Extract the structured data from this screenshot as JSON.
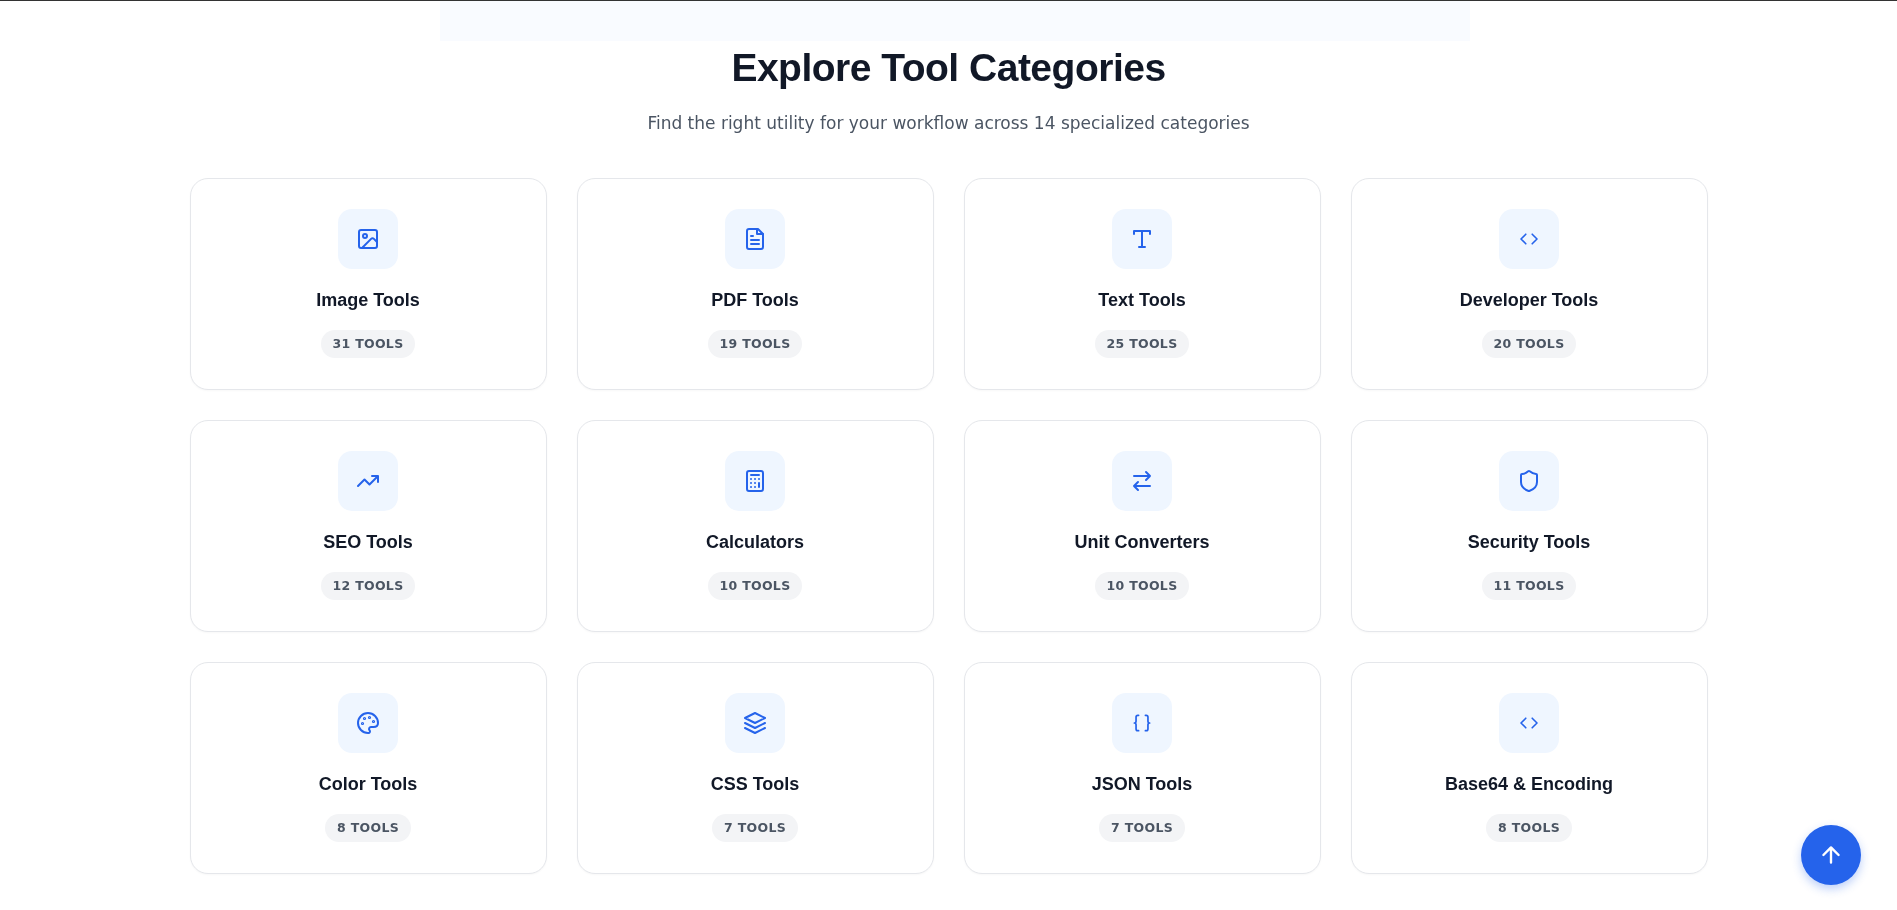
{
  "header": {
    "title": "Explore Tool Categories",
    "subtitle": "Find the right utility for your workflow across 14 specialized categories"
  },
  "categories": [
    {
      "name": "Image Tools",
      "count": "31 TOOLS"
    },
    {
      "name": "PDF Tools",
      "count": "19 TOOLS"
    },
    {
      "name": "Text Tools",
      "count": "25 TOOLS"
    },
    {
      "name": "Developer Tools",
      "count": "20 TOOLS"
    },
    {
      "name": "SEO Tools",
      "count": "12 TOOLS"
    },
    {
      "name": "Calculators",
      "count": "10 TOOLS"
    },
    {
      "name": "Unit Converters",
      "count": "10 TOOLS"
    },
    {
      "name": "Security Tools",
      "count": "11 TOOLS"
    },
    {
      "name": "Color Tools",
      "count": "8 TOOLS"
    },
    {
      "name": "CSS Tools",
      "count": "7 TOOLS"
    },
    {
      "name": "JSON Tools",
      "count": "7 TOOLS"
    },
    {
      "name": "Base64 & Encoding",
      "count": "8 TOOLS"
    }
  ]
}
